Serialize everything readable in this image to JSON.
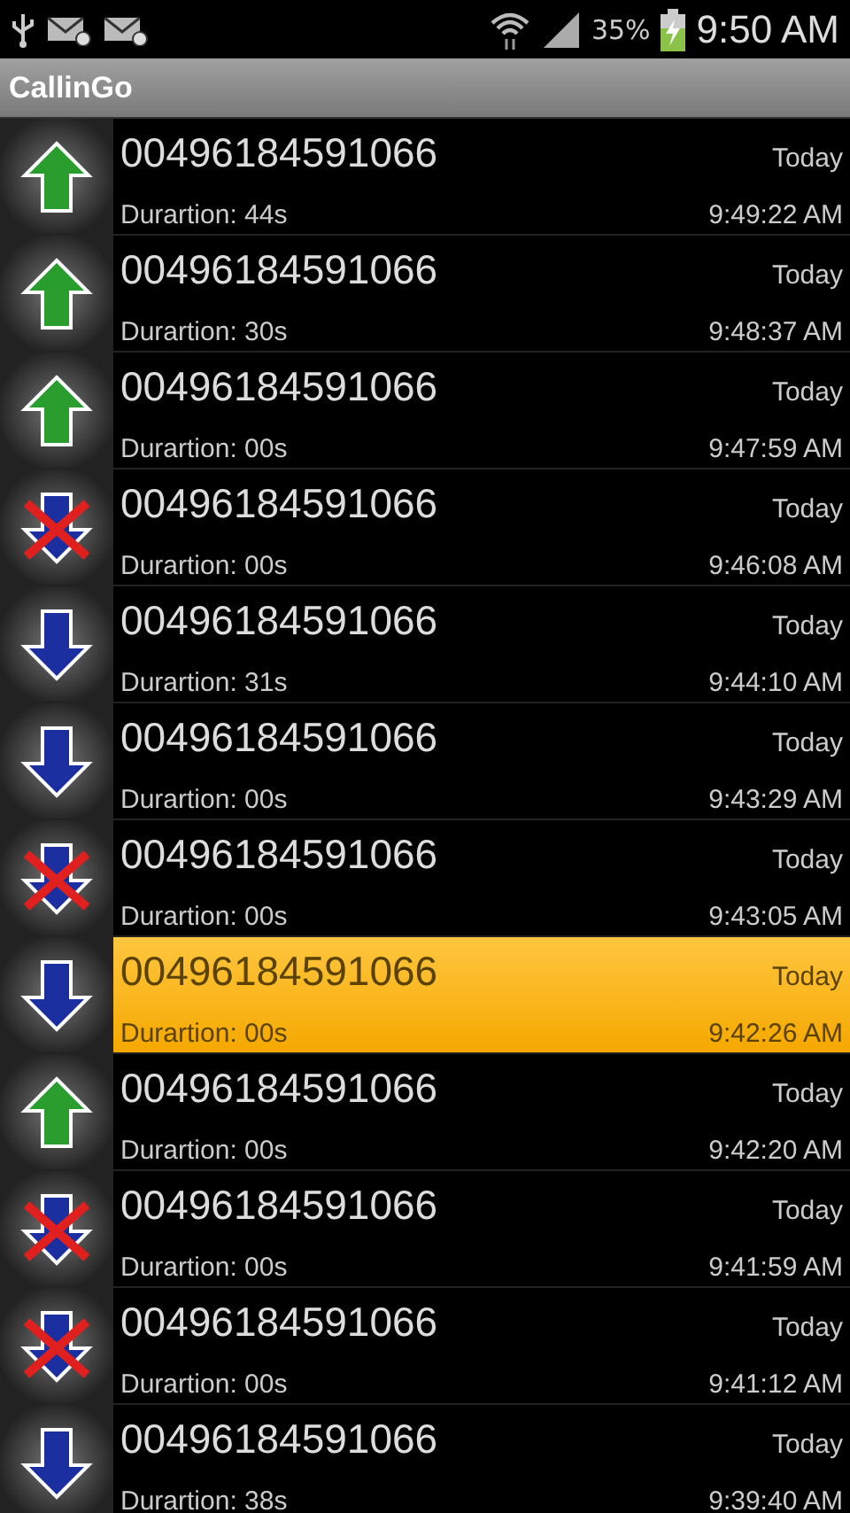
{
  "status_bar": {
    "battery": "35%",
    "time": "9:50 AM"
  },
  "app_bar": {
    "title": "CallinGo"
  },
  "calls": [
    {
      "kind": "outgoing",
      "number": "00496184591066",
      "duration": "Durartion: 44s",
      "day": "Today",
      "time": "9:49:22 AM",
      "selected": false
    },
    {
      "kind": "outgoing",
      "number": "00496184591066",
      "duration": "Durartion: 30s",
      "day": "Today",
      "time": "9:48:37 AM",
      "selected": false
    },
    {
      "kind": "outgoing",
      "number": "00496184591066",
      "duration": "Durartion: 00s",
      "day": "Today",
      "time": "9:47:59 AM",
      "selected": false
    },
    {
      "kind": "missed",
      "number": "00496184591066",
      "duration": "Durartion: 00s",
      "day": "Today",
      "time": "9:46:08 AM",
      "selected": false
    },
    {
      "kind": "incoming",
      "number": "00496184591066",
      "duration": "Durartion: 31s",
      "day": "Today",
      "time": "9:44:10 AM",
      "selected": false
    },
    {
      "kind": "incoming",
      "number": "00496184591066",
      "duration": "Durartion: 00s",
      "day": "Today",
      "time": "9:43:29 AM",
      "selected": false
    },
    {
      "kind": "missed",
      "number": "00496184591066",
      "duration": "Durartion: 00s",
      "day": "Today",
      "time": "9:43:05 AM",
      "selected": false
    },
    {
      "kind": "incoming",
      "number": "00496184591066",
      "duration": "Durartion: 00s",
      "day": "Today",
      "time": "9:42:26 AM",
      "selected": true
    },
    {
      "kind": "outgoing",
      "number": "00496184591066",
      "duration": "Durartion: 00s",
      "day": "Today",
      "time": "9:42:20 AM",
      "selected": false
    },
    {
      "kind": "missed",
      "number": "00496184591066",
      "duration": "Durartion: 00s",
      "day": "Today",
      "time": "9:41:59 AM",
      "selected": false
    },
    {
      "kind": "missed",
      "number": "00496184591066",
      "duration": "Durartion: 00s",
      "day": "Today",
      "time": "9:41:12 AM",
      "selected": false
    },
    {
      "kind": "incoming",
      "number": "00496184591066",
      "duration": "Durartion: 38s",
      "day": "Today",
      "time": "9:39:40 AM",
      "selected": false
    }
  ]
}
